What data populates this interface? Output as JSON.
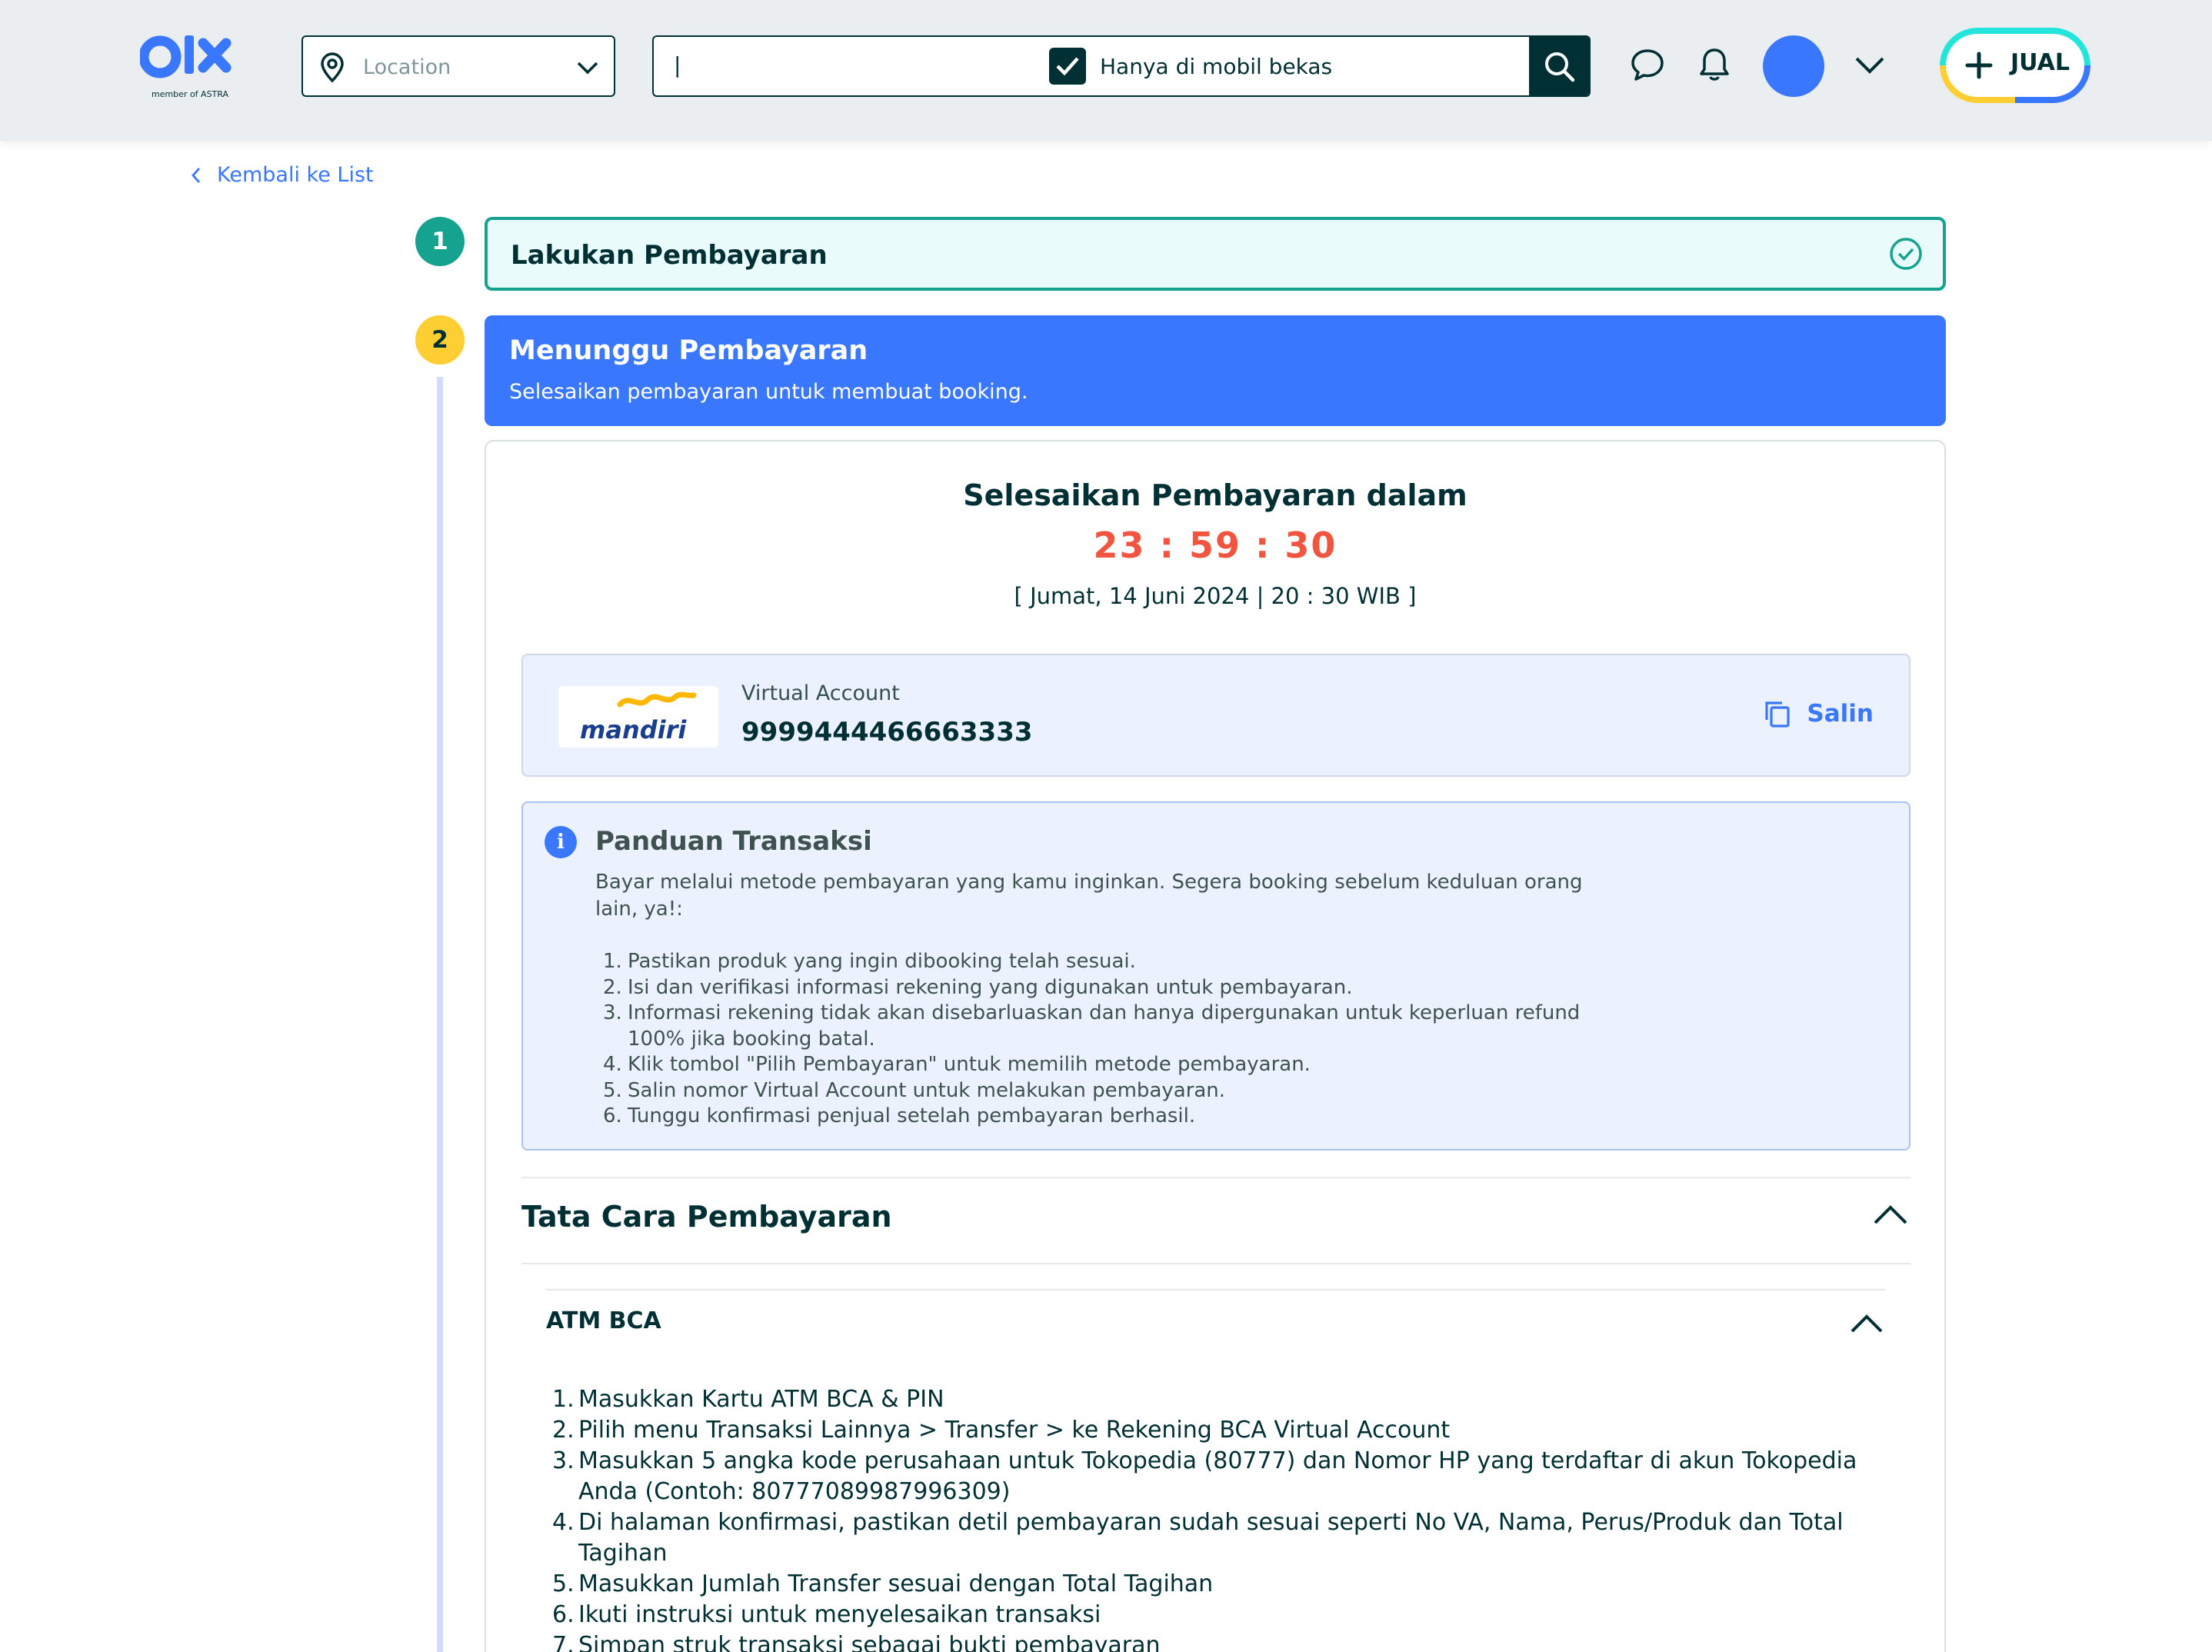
{
  "header": {
    "logo_text": "olx",
    "logo_sub": "member of ASTRA",
    "location_placeholder": "Location",
    "search_value": "|",
    "search_filter_label": "Hanya di mobil bekas",
    "sell_label": "JUAL"
  },
  "back_link": "Kembali ke List",
  "steps": [
    {
      "number": "1",
      "title": "Lakukan Pembayaran"
    },
    {
      "number": "2",
      "title": "Menunggu Pembayaran",
      "subtitle": "Selesaikan pembayaran untuk membuat booking."
    }
  ],
  "payment": {
    "countdown_title": "Selesaikan Pembayaran dalam",
    "countdown": "23 : 59 : 30",
    "deadline": "[ Jumat, 14 Juni 2024 | 20 : 30 WIB ]",
    "bank": "mandiri",
    "va_label": "Virtual Account",
    "va_number": "9999444466663333",
    "copy_label": "Salin"
  },
  "guide": {
    "title": "Panduan Transaksi",
    "intro": "Bayar melalui metode pembayaran yang kamu inginkan. Segera booking sebelum keduluan orang lain, ya!:",
    "items": [
      "Pastikan produk yang ingin dibooking telah sesuai.",
      "Isi dan verifikasi informasi rekening yang digunakan untuk pembayaran.",
      "Informasi rekening tidak akan disebarluaskan dan hanya dipergunakan untuk keperluan refund 100% jika booking batal.",
      "Klik tombol \"Pilih Pembayaran\" untuk memilih metode pembayaran.",
      "Salin nomor Virtual Account untuk melakukan pembayaran.",
      "Tunggu konfirmasi penjual setelah pembayaran berhasil."
    ]
  },
  "how_to": {
    "title": "Tata Cara Pembayaran",
    "method": "ATM BCA",
    "steps": [
      "Masukkan Kartu ATM BCA & PIN",
      "Pilih menu Transaksi Lainnya > Transfer > ke Rekening BCA Virtual Account",
      "Masukkan 5 angka kode perusahaan untuk Tokopedia (80777) dan Nomor HP yang terdaftar di akun Tokopedia Anda (Contoh: 80777089987996309)",
      "Di halaman konfirmasi, pastikan detil pembayaran sudah sesuai seperti No VA, Nama, Perus/Produk dan Total Tagihan",
      "Masukkan Jumlah Transfer sesuai dengan Total Tagihan",
      "Ikuti instruksi untuk menyelesaikan transaksi",
      "Simpan struk transaksi sebagai bukti pembayaran"
    ]
  },
  "colors": {
    "primary": "#002f34",
    "accent": "#3a77ff",
    "success": "#15a38f",
    "warning": "#ffce32",
    "timer": "#f2553f"
  }
}
